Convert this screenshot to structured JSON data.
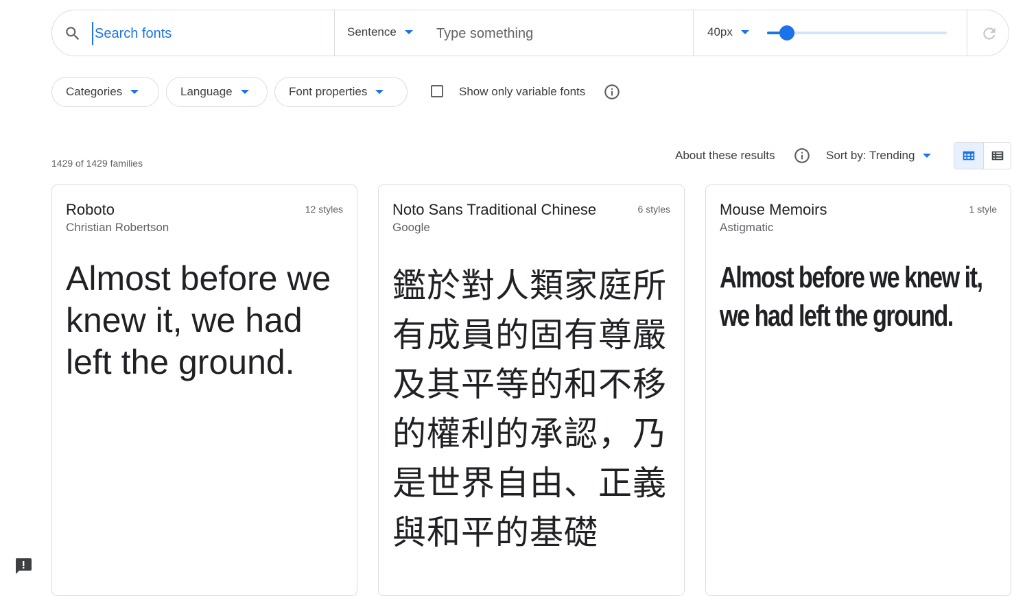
{
  "search": {
    "placeholder": "Search fonts",
    "value": ""
  },
  "preview_mode": {
    "selected": "Sentence"
  },
  "preview_text": {
    "placeholder": "Type something",
    "value": ""
  },
  "size": {
    "selected": "40px",
    "slider_fraction": 0.11
  },
  "filters": {
    "categories": "Categories",
    "language": "Language",
    "font_properties": "Font properties",
    "variable_only": {
      "label": "Show only variable fonts",
      "checked": false
    }
  },
  "results": {
    "count": "1429 of 1429 families",
    "about": "About these results",
    "sort": "Sort by: Trending",
    "view": {
      "grid_active": true
    }
  },
  "cards": [
    {
      "name": "Roboto",
      "author": "Christian Robertson",
      "styles": "12 styles",
      "preview": "Almost before we knew it, we had left the ground."
    },
    {
      "name": "Noto Sans Traditional Chinese",
      "author": "Google",
      "styles": "6 styles",
      "preview": "鑑於對人類家庭所有成員的固有尊嚴及其平等的和不移的權利的承認，乃是世界自由、正義與和平的基礎"
    },
    {
      "name": "Mouse Memoirs",
      "author": "Astigmatic",
      "styles": "1 style",
      "preview": "Almost before we knew it, we had left the ground."
    }
  ],
  "colors": {
    "accent": "#1a73e8",
    "border": "#dadce0",
    "text_primary": "#202124",
    "text_secondary": "#5f6368"
  },
  "icons": {
    "search": "search-icon",
    "reset": "refresh-icon",
    "info": "info-icon",
    "grid": "grid-view-icon",
    "list": "list-view-icon",
    "feedback": "feedback-icon"
  }
}
